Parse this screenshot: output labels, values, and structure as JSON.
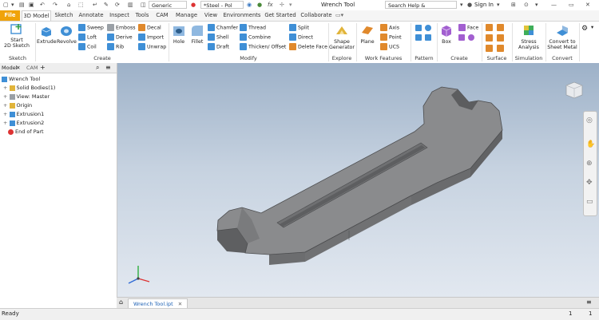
{
  "titlebar": {
    "appearance_label": "Generic",
    "material_label": "*Steel - Pol",
    "doc_title": "Wrench Tool",
    "search_placeholder": "Search Help & Commands...",
    "sign_in": "Sign In"
  },
  "tabs": [
    "File",
    "3D Model",
    "Sketch",
    "Annotate",
    "Inspect",
    "Tools",
    "CAM",
    "Manage",
    "View",
    "Environments",
    "Get Started",
    "Collaborate"
  ],
  "ribbon": {
    "sketch": {
      "start_label": "Start",
      "start_label2": "2D Sketch",
      "panel": "Sketch"
    },
    "create": {
      "extrude": "Extrude",
      "revolve": "Revolve",
      "sweep": "Sweep",
      "loft": "Loft",
      "coil": "Coil",
      "emboss": "Emboss",
      "derive": "Derive",
      "rib": "Rib",
      "decal": "Decal",
      "import": "Import",
      "unwrap": "Unwrap",
      "panel": "Create"
    },
    "modify": {
      "hole": "Hole",
      "fillet": "Fillet",
      "chamfer": "Chamfer",
      "shell": "Shell",
      "draft": "Draft",
      "thread": "Thread",
      "combine": "Combine",
      "thicken": "Thicken/ Offset",
      "split": "Split",
      "direct": "Direct",
      "delete_face": "Delete Face",
      "panel": "Modify"
    },
    "explore": {
      "shape1": "Shape",
      "shape2": "Generator",
      "panel": "Explore"
    },
    "work_features": {
      "plane": "Plane",
      "axis": "Axis",
      "point": "Point",
      "ucs": "UCS",
      "panel": "Work Features"
    },
    "pattern": {
      "panel": "Pattern"
    },
    "freeform": {
      "box": "Box",
      "face": "Face",
      "panel": "Create Freeform"
    },
    "surface": {
      "panel": "Surface"
    },
    "simulation": {
      "stress1": "Stress",
      "stress2": "Analysis",
      "panel": "Simulation"
    },
    "convert": {
      "convert1": "Convert to",
      "convert2": "Sheet Metal",
      "panel": "Convert"
    }
  },
  "browser": {
    "tabs": [
      "Model",
      "CAM"
    ],
    "tree": [
      "Wrench Tool",
      "Solid Bodies(1)",
      "View: Master",
      "Origin",
      "Extrusion1",
      "Extrusion2",
      "End of Part"
    ]
  },
  "doc_tab": "Wrench Tool.ipt",
  "status": {
    "text": "Ready",
    "count1": "1",
    "count2": "1"
  }
}
